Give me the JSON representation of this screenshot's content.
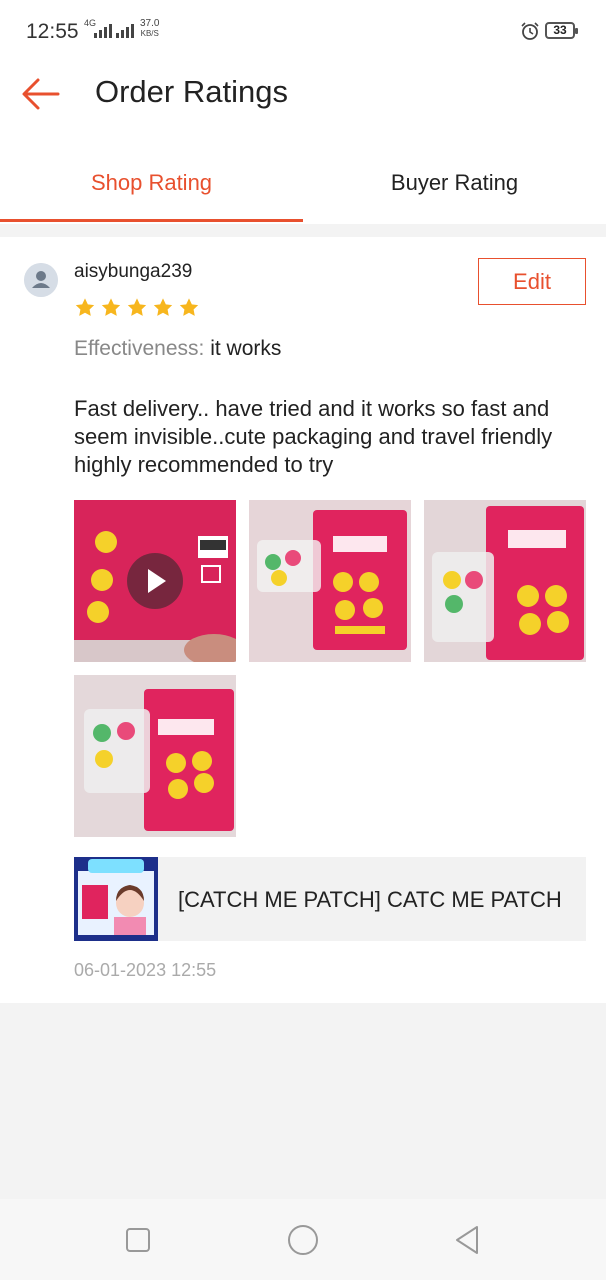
{
  "status_bar": {
    "time": "12:55",
    "network_type": "4G",
    "speed_value": "37.0",
    "speed_unit": "KB/S",
    "battery": "33",
    "alarm_icon": "alarm-clock-icon"
  },
  "header": {
    "back_icon": "arrow-left-icon",
    "title": "Order Ratings"
  },
  "tabs": [
    {
      "label": "Shop Rating",
      "active": true
    },
    {
      "label": "Buyer Rating",
      "active": false
    }
  ],
  "rating": {
    "username": "aisybunga239",
    "edit_label": "Edit",
    "stars": 5,
    "attribute_label": "Effectiveness:",
    "attribute_value": "it works",
    "review_text": "Fast delivery.. have tried and it works so fast and seem invisible..cute packaging and travel friendly highly recommended to try",
    "media": [
      {
        "type": "video",
        "icon": "play-icon"
      },
      {
        "type": "image"
      },
      {
        "type": "image"
      },
      {
        "type": "image"
      }
    ],
    "product": {
      "name": "[CATCH ME PATCH] CATC ME PATCH"
    },
    "date": "06-01-2023 12:55"
  },
  "navigation_bar": {
    "icons": [
      "square-recents-icon",
      "circle-home-icon",
      "triangle-back-icon"
    ]
  },
  "colors": {
    "accent": "#e8502e",
    "star": "#f7b61e",
    "background": "#f3f3f3"
  }
}
